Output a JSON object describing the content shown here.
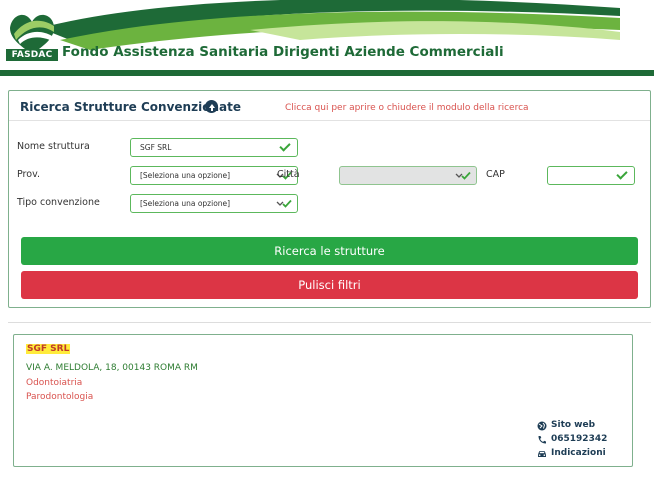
{
  "header": {
    "logo_text": "FASDAC",
    "title": "Fondo Assistenza Sanitaria Dirigenti Aziende Commerciali"
  },
  "search": {
    "title": "Ricerca Strutture Convenzionate",
    "hint": "Clicca qui per aprire o chiudere il modulo della ricerca",
    "labels": {
      "nome": "Nome struttura",
      "prov": "Prov.",
      "citta": "Città",
      "cap": "CAP",
      "tipo": "Tipo convenzione"
    },
    "values": {
      "nome": "SGF SRL",
      "prov": "[Seleziona una opzione]",
      "citta": "",
      "cap": "",
      "tipo": "[Seleziona una opzione]"
    },
    "search_button": "Ricerca le strutture",
    "clear_button": "Pulisci filtri"
  },
  "result": {
    "name": "SGF SRL",
    "address": "VIA A. MELDOLA, 18, 00143 ROMA RM",
    "specialties": [
      "Odontoiatria",
      "Parodontologia"
    ],
    "links": {
      "website": "Sito web",
      "phone": "065192342",
      "directions": "Indicazioni"
    }
  },
  "colors": {
    "brand_green": "#1e6a37",
    "accent_green": "#28a745",
    "danger_red": "#dc3545",
    "navy": "#1e3d55"
  }
}
